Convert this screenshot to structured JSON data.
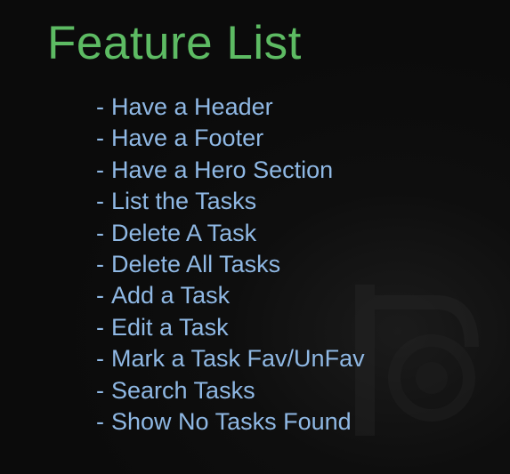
{
  "slide": {
    "title": "Feature List",
    "colors": {
      "background": "#0b0b0b",
      "title": "#5dbb63",
      "list_text": "#8fb8e4"
    },
    "bullet_marker": "-",
    "features": [
      {
        "label": "Have a Header"
      },
      {
        "label": "Have a Footer"
      },
      {
        "label": "Have a Hero Section"
      },
      {
        "label": "List the Tasks"
      },
      {
        "label": "Delete A Task"
      },
      {
        "label": "Delete All Tasks"
      },
      {
        "label": "Add a Task"
      },
      {
        "label": "Edit a Task"
      },
      {
        "label": "Mark a Task Fav/UnFav"
      },
      {
        "label": "Search Tasks"
      },
      {
        "label": "Show No Tasks Found"
      }
    ]
  }
}
